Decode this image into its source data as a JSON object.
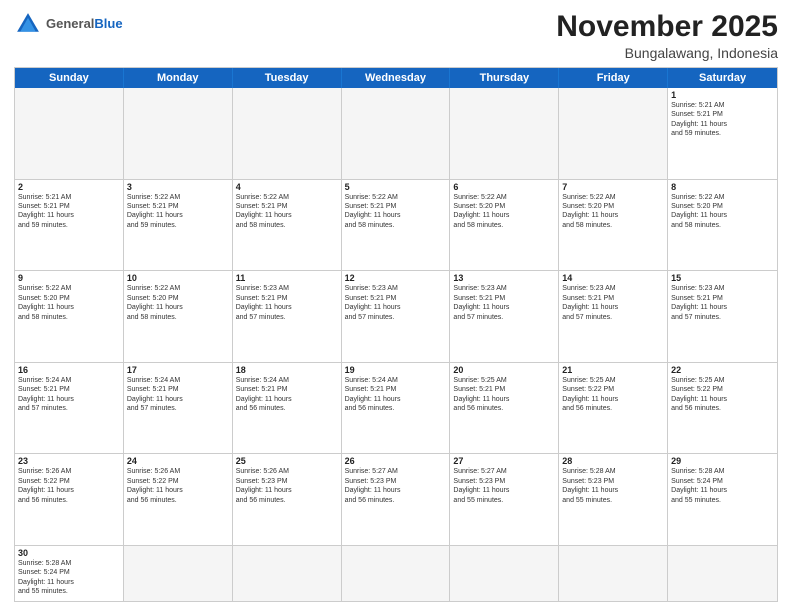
{
  "header": {
    "logo_general": "General",
    "logo_blue": "Blue",
    "month_title": "November 2025",
    "location": "Bungalawang, Indonesia"
  },
  "weekdays": [
    "Sunday",
    "Monday",
    "Tuesday",
    "Wednesday",
    "Thursday",
    "Friday",
    "Saturday"
  ],
  "rows": [
    [
      {
        "day": "",
        "info": ""
      },
      {
        "day": "",
        "info": ""
      },
      {
        "day": "",
        "info": ""
      },
      {
        "day": "",
        "info": ""
      },
      {
        "day": "",
        "info": ""
      },
      {
        "day": "",
        "info": ""
      },
      {
        "day": "1",
        "info": "Sunrise: 5:21 AM\nSunset: 5:21 PM\nDaylight: 11 hours\nand 59 minutes."
      }
    ],
    [
      {
        "day": "2",
        "info": "Sunrise: 5:21 AM\nSunset: 5:21 PM\nDaylight: 11 hours\nand 59 minutes."
      },
      {
        "day": "3",
        "info": "Sunrise: 5:22 AM\nSunset: 5:21 PM\nDaylight: 11 hours\nand 59 minutes."
      },
      {
        "day": "4",
        "info": "Sunrise: 5:22 AM\nSunset: 5:21 PM\nDaylight: 11 hours\nand 58 minutes."
      },
      {
        "day": "5",
        "info": "Sunrise: 5:22 AM\nSunset: 5:21 PM\nDaylight: 11 hours\nand 58 minutes."
      },
      {
        "day": "6",
        "info": "Sunrise: 5:22 AM\nSunset: 5:20 PM\nDaylight: 11 hours\nand 58 minutes."
      },
      {
        "day": "7",
        "info": "Sunrise: 5:22 AM\nSunset: 5:20 PM\nDaylight: 11 hours\nand 58 minutes."
      },
      {
        "day": "8",
        "info": "Sunrise: 5:22 AM\nSunset: 5:20 PM\nDaylight: 11 hours\nand 58 minutes."
      }
    ],
    [
      {
        "day": "9",
        "info": "Sunrise: 5:22 AM\nSunset: 5:20 PM\nDaylight: 11 hours\nand 58 minutes."
      },
      {
        "day": "10",
        "info": "Sunrise: 5:22 AM\nSunset: 5:20 PM\nDaylight: 11 hours\nand 58 minutes."
      },
      {
        "day": "11",
        "info": "Sunrise: 5:23 AM\nSunset: 5:21 PM\nDaylight: 11 hours\nand 57 minutes."
      },
      {
        "day": "12",
        "info": "Sunrise: 5:23 AM\nSunset: 5:21 PM\nDaylight: 11 hours\nand 57 minutes."
      },
      {
        "day": "13",
        "info": "Sunrise: 5:23 AM\nSunset: 5:21 PM\nDaylight: 11 hours\nand 57 minutes."
      },
      {
        "day": "14",
        "info": "Sunrise: 5:23 AM\nSunset: 5:21 PM\nDaylight: 11 hours\nand 57 minutes."
      },
      {
        "day": "15",
        "info": "Sunrise: 5:23 AM\nSunset: 5:21 PM\nDaylight: 11 hours\nand 57 minutes."
      }
    ],
    [
      {
        "day": "16",
        "info": "Sunrise: 5:24 AM\nSunset: 5:21 PM\nDaylight: 11 hours\nand 57 minutes."
      },
      {
        "day": "17",
        "info": "Sunrise: 5:24 AM\nSunset: 5:21 PM\nDaylight: 11 hours\nand 57 minutes."
      },
      {
        "day": "18",
        "info": "Sunrise: 5:24 AM\nSunset: 5:21 PM\nDaylight: 11 hours\nand 56 minutes."
      },
      {
        "day": "19",
        "info": "Sunrise: 5:24 AM\nSunset: 5:21 PM\nDaylight: 11 hours\nand 56 minutes."
      },
      {
        "day": "20",
        "info": "Sunrise: 5:25 AM\nSunset: 5:21 PM\nDaylight: 11 hours\nand 56 minutes."
      },
      {
        "day": "21",
        "info": "Sunrise: 5:25 AM\nSunset: 5:22 PM\nDaylight: 11 hours\nand 56 minutes."
      },
      {
        "day": "22",
        "info": "Sunrise: 5:25 AM\nSunset: 5:22 PM\nDaylight: 11 hours\nand 56 minutes."
      }
    ],
    [
      {
        "day": "23",
        "info": "Sunrise: 5:26 AM\nSunset: 5:22 PM\nDaylight: 11 hours\nand 56 minutes."
      },
      {
        "day": "24",
        "info": "Sunrise: 5:26 AM\nSunset: 5:22 PM\nDaylight: 11 hours\nand 56 minutes."
      },
      {
        "day": "25",
        "info": "Sunrise: 5:26 AM\nSunset: 5:23 PM\nDaylight: 11 hours\nand 56 minutes."
      },
      {
        "day": "26",
        "info": "Sunrise: 5:27 AM\nSunset: 5:23 PM\nDaylight: 11 hours\nand 56 minutes."
      },
      {
        "day": "27",
        "info": "Sunrise: 5:27 AM\nSunset: 5:23 PM\nDaylight: 11 hours\nand 55 minutes."
      },
      {
        "day": "28",
        "info": "Sunrise: 5:28 AM\nSunset: 5:23 PM\nDaylight: 11 hours\nand 55 minutes."
      },
      {
        "day": "29",
        "info": "Sunrise: 5:28 AM\nSunset: 5:24 PM\nDaylight: 11 hours\nand 55 minutes."
      }
    ],
    [
      {
        "day": "30",
        "info": "Sunrise: 5:28 AM\nSunset: 5:24 PM\nDaylight: 11 hours\nand 55 minutes."
      },
      {
        "day": "",
        "info": ""
      },
      {
        "day": "",
        "info": ""
      },
      {
        "day": "",
        "info": ""
      },
      {
        "day": "",
        "info": ""
      },
      {
        "day": "",
        "info": ""
      },
      {
        "day": "",
        "info": ""
      }
    ]
  ]
}
